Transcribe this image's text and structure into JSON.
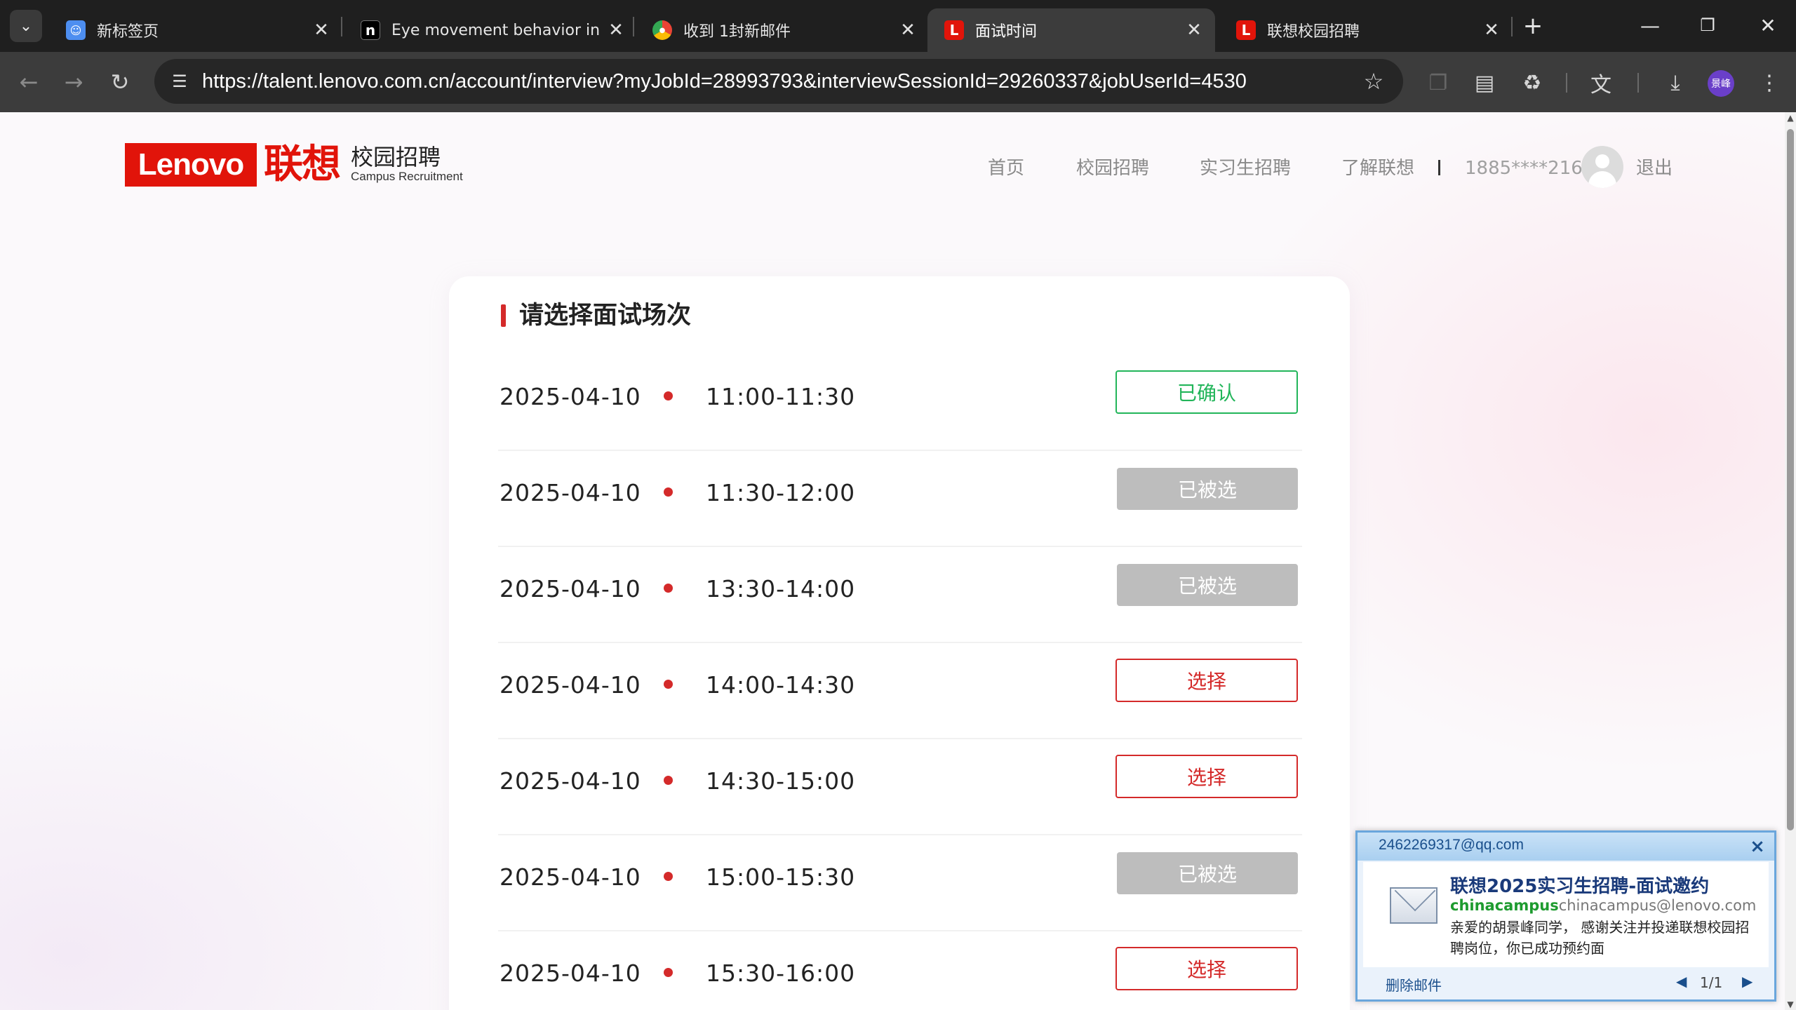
{
  "browser": {
    "tabs": [
      {
        "title": "新标签页",
        "favicon": "new-tab"
      },
      {
        "title": "Eye movement behavior in a",
        "favicon": "n"
      },
      {
        "title": "收到 1封新邮件",
        "favicon": "chrome"
      },
      {
        "title": "面试时间",
        "favicon": "L"
      },
      {
        "title": "联想校园招聘",
        "favicon": "L"
      }
    ],
    "url": "https://talent.lenovo.com.cn/account/interview?myJobId=28993793&interviewSessionId=29260337&jobUserId=4530",
    "profile_label": "景峰"
  },
  "site": {
    "logo_en": "Lenovo",
    "logo_cn": "联想",
    "logo_sub": "校园招聘",
    "logo_sub_en": "Campus Recruitment",
    "nav": [
      "首页",
      "校园招聘",
      "实习生招聘",
      "了解联想"
    ],
    "user_phone": "1885****216",
    "logout": "退出"
  },
  "card": {
    "title": "请选择面试场次",
    "slots": [
      {
        "date": "2025-04-10",
        "time": "11:00-11:30",
        "status": "已确认",
        "state": "confirmed"
      },
      {
        "date": "2025-04-10",
        "time": "11:30-12:00",
        "status": "已被选",
        "state": "taken"
      },
      {
        "date": "2025-04-10",
        "time": "13:30-14:00",
        "status": "已被选",
        "state": "taken"
      },
      {
        "date": "2025-04-10",
        "time": "14:00-14:30",
        "status": "选择",
        "state": "select"
      },
      {
        "date": "2025-04-10",
        "time": "14:30-15:00",
        "status": "选择",
        "state": "select"
      },
      {
        "date": "2025-04-10",
        "time": "15:00-15:30",
        "status": "已被选",
        "state": "taken"
      },
      {
        "date": "2025-04-10",
        "time": "15:30-16:00",
        "status": "选择",
        "state": "select"
      }
    ]
  },
  "mail_popup": {
    "account": "2462269317@qq.com",
    "subject": "联想2025实习生招聘-面试邀约",
    "sender_name": "chinacampus",
    "sender_email": "chinacampus@lenovo.com",
    "preview": "亲爱的胡景峰同学， 感谢关注并投递联想校园招聘岗位，你已成功预约面",
    "delete_label": "删除邮件",
    "page": "1/1"
  },
  "colors": {
    "brand_red": "#e1140a",
    "confirmed_green": "#22b55a",
    "taken_gray": "#bdbdbd",
    "select_red": "#d42a2a"
  }
}
